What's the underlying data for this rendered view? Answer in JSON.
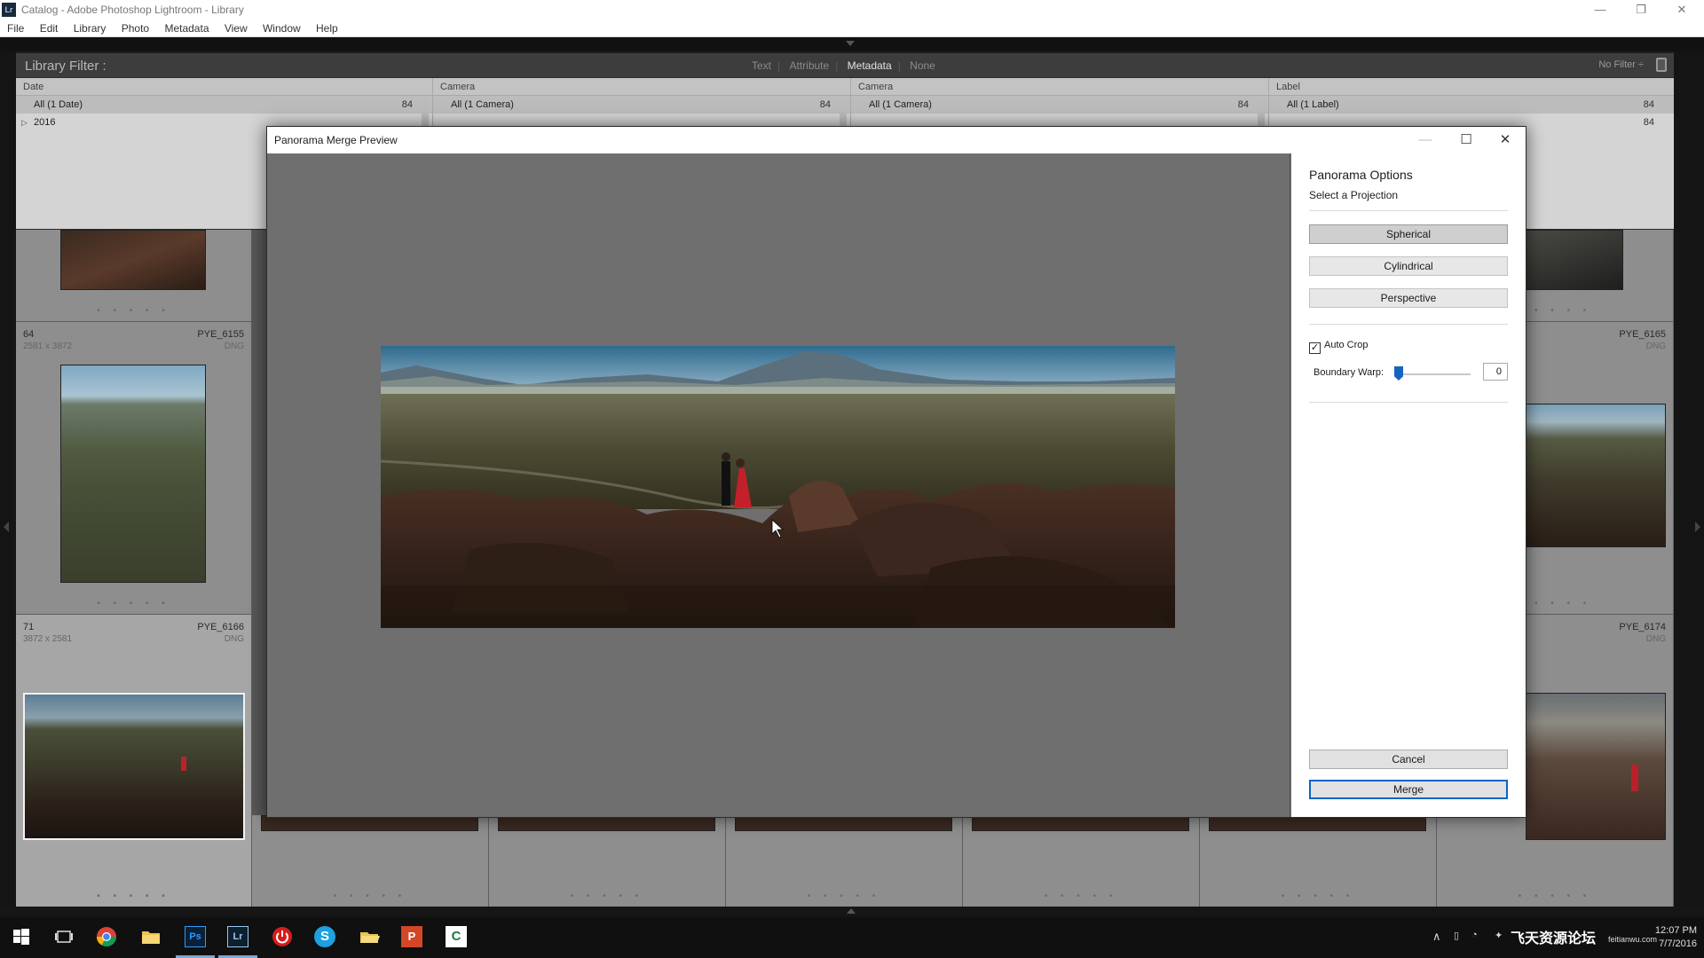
{
  "window": {
    "title": "Catalog - Adobe Photoshop Lightroom - Library",
    "app_icon": "Lr",
    "minimize": "—",
    "restore": "❐",
    "close": "✕"
  },
  "menu": [
    "File",
    "Edit",
    "Library",
    "Photo",
    "Metadata",
    "View",
    "Window",
    "Help"
  ],
  "library_filter": {
    "label": "Library Filter :",
    "options": [
      "Text",
      "Attribute",
      "Metadata",
      "None"
    ],
    "active": "Metadata",
    "preset": "No Filter ÷"
  },
  "metadata_columns": [
    {
      "header": "Date",
      "rows": [
        {
          "label": "All (1 Date)",
          "count": "84"
        },
        {
          "label": "2016",
          "count": ""
        }
      ]
    },
    {
      "header": "Camera",
      "rows": [
        {
          "label": "All (1 Camera)",
          "count": "84"
        }
      ]
    },
    {
      "header": "Camera",
      "rows": [
        {
          "label": "All (1 Camera)",
          "count": "84"
        }
      ]
    },
    {
      "header": "Label",
      "rows": [
        {
          "label": "All (1 Label)",
          "count": "84"
        },
        {
          "label": "",
          "count": "84"
        }
      ]
    }
  ],
  "grid_cells": [
    {
      "index": "64",
      "dims": "2581 x 3872",
      "name": "PYE_6155",
      "type": "DNG"
    },
    {
      "index": "71",
      "dims": "3872 x 2581",
      "name": "PYE_6166",
      "type": "DNG"
    },
    {
      "index": "",
      "dims": "",
      "name": "PYE_6165",
      "type": "DNG"
    },
    {
      "index": "",
      "dims": "",
      "name": "PYE_6174",
      "type": "DNG"
    }
  ],
  "dialog": {
    "title": "Panorama Merge Preview",
    "minimize": "—",
    "maximize": "☐",
    "close": "✕",
    "options_title": "Panorama Options",
    "projection_label": "Select a Projection",
    "projections": [
      "Spherical",
      "Cylindrical",
      "Perspective"
    ],
    "selected_projection": "Spherical",
    "auto_crop_label": "Auto Crop",
    "auto_crop_checked": true,
    "boundary_warp_label": "Boundary Warp:",
    "boundary_warp_value": "0",
    "cancel_label": "Cancel",
    "merge_label": "Merge"
  },
  "taskbar": {
    "icons": [
      "windows-start-icon",
      "task-view-icon",
      "chrome-icon",
      "file-explorer-icon",
      "photoshop-icon",
      "lightroom-icon",
      "power-app-icon",
      "skype-icon",
      "folder-icon",
      "powerpoint-icon",
      "camtasia-icon"
    ],
    "photoshop_label": "Ps",
    "lightroom_label": "Lr",
    "skype_label": "S",
    "powerpoint_label": "P",
    "camtasia_label": "C",
    "tray_watermark": "飞天资源论坛",
    "tray_watermark_url": "feitianwu.com",
    "time": "12:07 PM",
    "date": "7/7/2016"
  },
  "colors": {
    "accent": "#0a64c8",
    "slider": "#1565c0",
    "lr_dark": "#1e1e1e"
  }
}
